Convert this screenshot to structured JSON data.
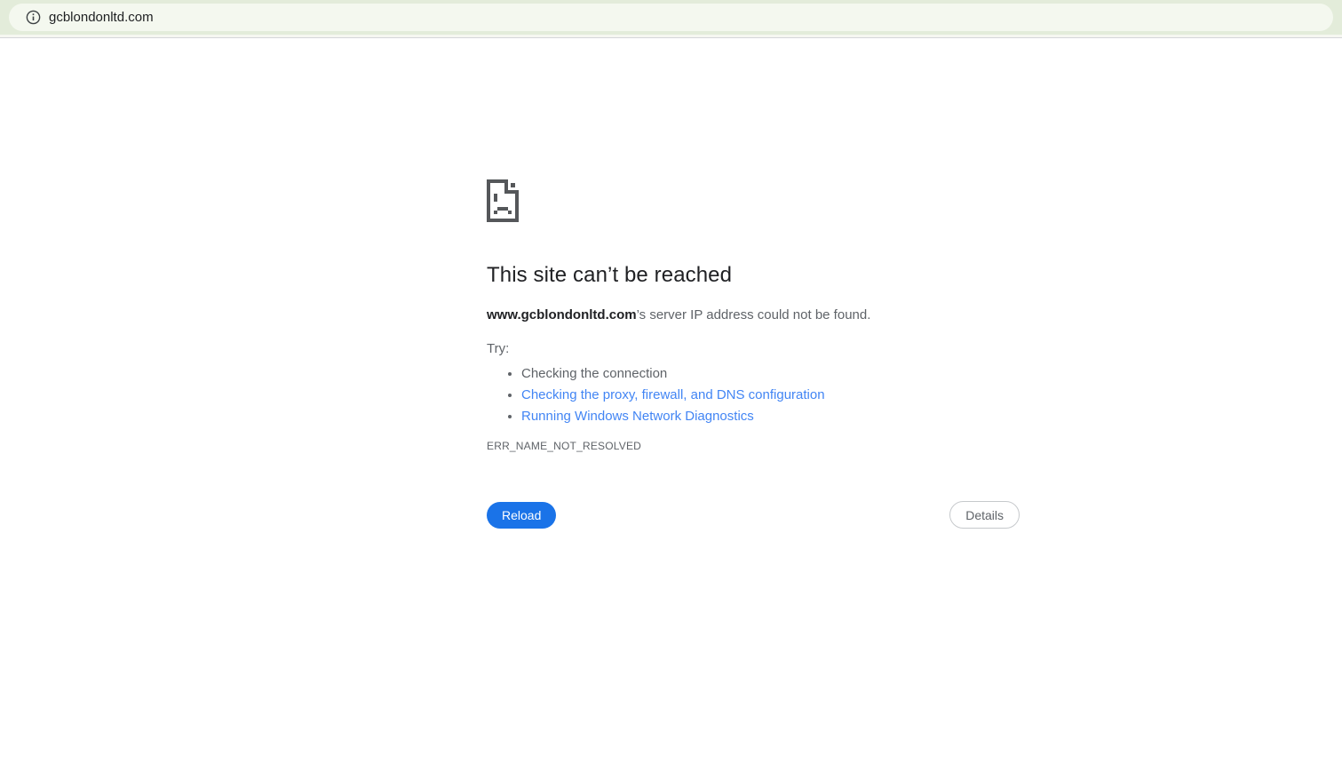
{
  "address_bar": {
    "url": "gcblondonltd.com"
  },
  "error_page": {
    "title": "This site can’t be reached",
    "error_domain": "www.gcblondonltd.com",
    "error_message_rest": "’s server IP address could not be found.",
    "try_label": "Try:",
    "suggestions": [
      {
        "label": "Checking the connection",
        "is_link": false
      },
      {
        "label": "Checking the proxy, firewall, and DNS configuration",
        "is_link": true
      },
      {
        "label": "Running Windows Network Diagnostics",
        "is_link": true
      }
    ],
    "error_code": "ERR_NAME_NOT_RESOLVED",
    "buttons": {
      "reload": "Reload",
      "details": "Details"
    }
  },
  "colors": {
    "toolbar_background": "#e3ecda",
    "omnibox_background": "#f4f8ef",
    "reload_button_blue": "#1a73e8",
    "link_blue": "#4285f4",
    "heading_text": "#202124",
    "body_text": "#5f6368",
    "icon_gray": "#55575a"
  }
}
